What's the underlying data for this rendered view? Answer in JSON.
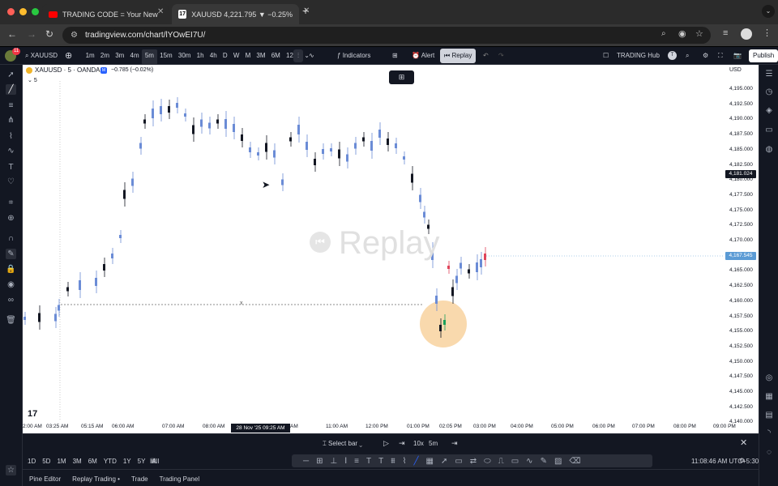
{
  "browser": {
    "tabs": [
      {
        "title": "TRADING CODE = Your New"
      },
      {
        "title": "XAUUSD 4,221.795 ▼ −0.25%"
      }
    ],
    "url": "tradingview.com/chart/lYOwEI7U/",
    "badge": "11"
  },
  "toolbar": {
    "symbol": "XAUUSD",
    "intervals": [
      "1m",
      "2m",
      "3m",
      "4m",
      "5m",
      "15m",
      "30m",
      "1h",
      "4h",
      "D",
      "W",
      "M",
      "3M",
      "6M",
      "12M"
    ],
    "active_interval": "5m",
    "indicators_label": "Indicators",
    "alert_label": "Alert",
    "replay_label": "Replay",
    "hub_label": "TRADING Hub",
    "publish_label": "Publish"
  },
  "chart": {
    "symbol_line": "XAUUSD · 5 · OANDA",
    "change": "−0.785 (−0.02%)",
    "sub_count": "5",
    "currency": "USD",
    "watermark": "Replay",
    "price_labels": [
      "4,195.000",
      "4,192.500",
      "4,190.000",
      "4,187.500",
      "4,185.000",
      "4,182.500",
      "4,180.000",
      "4,177.500",
      "4,175.000",
      "4,172.500",
      "4,170.000",
      "4,167.500",
      "4,165.000",
      "4,162.500",
      "4,160.000",
      "4,157.500",
      "4,155.000",
      "4,152.500",
      "4,150.000",
      "4,147.500",
      "4,145.000",
      "4,142.500",
      "4,140.000"
    ],
    "price_tag_black": "4,181.024",
    "price_tag_blue": "4,167.545",
    "time_labels": [
      "2:00 AM",
      "03:25 AM",
      "05:15 AM",
      "06:00 AM",
      "07:00 AM",
      "08:00 AM",
      "AM",
      "11:00 AM",
      "12:00 PM",
      "01:00 PM",
      "02:05 PM",
      "03:00 PM",
      "04:00 PM",
      "05:00 PM",
      "06:00 PM",
      "07:00 PM",
      "08:00 PM",
      "09:00 PM"
    ],
    "time_highlight": "28 Nov '25   09:25 AM",
    "line_marker": "x",
    "colors": {
      "bull": "#6b8cd6",
      "bear": "#131722",
      "accent": "#e0445a",
      "green": "#19a05a",
      "highlight": "#f7c98a"
    }
  },
  "replay_bar": {
    "select_bar": "Select bar",
    "speed": "10x",
    "interval": "5m"
  },
  "ranges": [
    "1D",
    "5D",
    "1M",
    "3M",
    "6M",
    "YTD",
    "1Y",
    "5Y",
    "All"
  ],
  "clock": "11:08:46 AM UTC+5:30",
  "bottom_tabs": [
    "Pine Editor",
    "Replay Trading •",
    "Trade",
    "Trading Panel"
  ]
}
